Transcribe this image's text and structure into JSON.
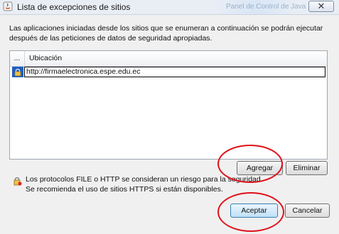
{
  "window": {
    "title": "Lista de excepciones de sitios",
    "background_title": "Panel de Control de Java",
    "close_label": "✕"
  },
  "intro": "Las aplicaciones iniciadas desde los sitios que se enumeran a continuación se podrán ejecutar después de las peticiones de datos de seguridad apropiadas.",
  "table": {
    "col_dots": "...",
    "col_location": "Ubicación",
    "rows": [
      {
        "location": "http://firmaelectronica.espe.edu.ec"
      }
    ]
  },
  "buttons": {
    "add": "Agregar",
    "remove": "Eliminar",
    "ok": "Aceptar",
    "cancel": "Cancelar"
  },
  "warning": {
    "line1": "Los protocolos FILE o HTTP se consideran un riesgo para la seguridad.",
    "line2": "Se recomienda el uso de sitios HTTPS si están disponibles."
  },
  "colors": {
    "annotation": "#e0101a",
    "accent_button": "#3c7fb1"
  }
}
